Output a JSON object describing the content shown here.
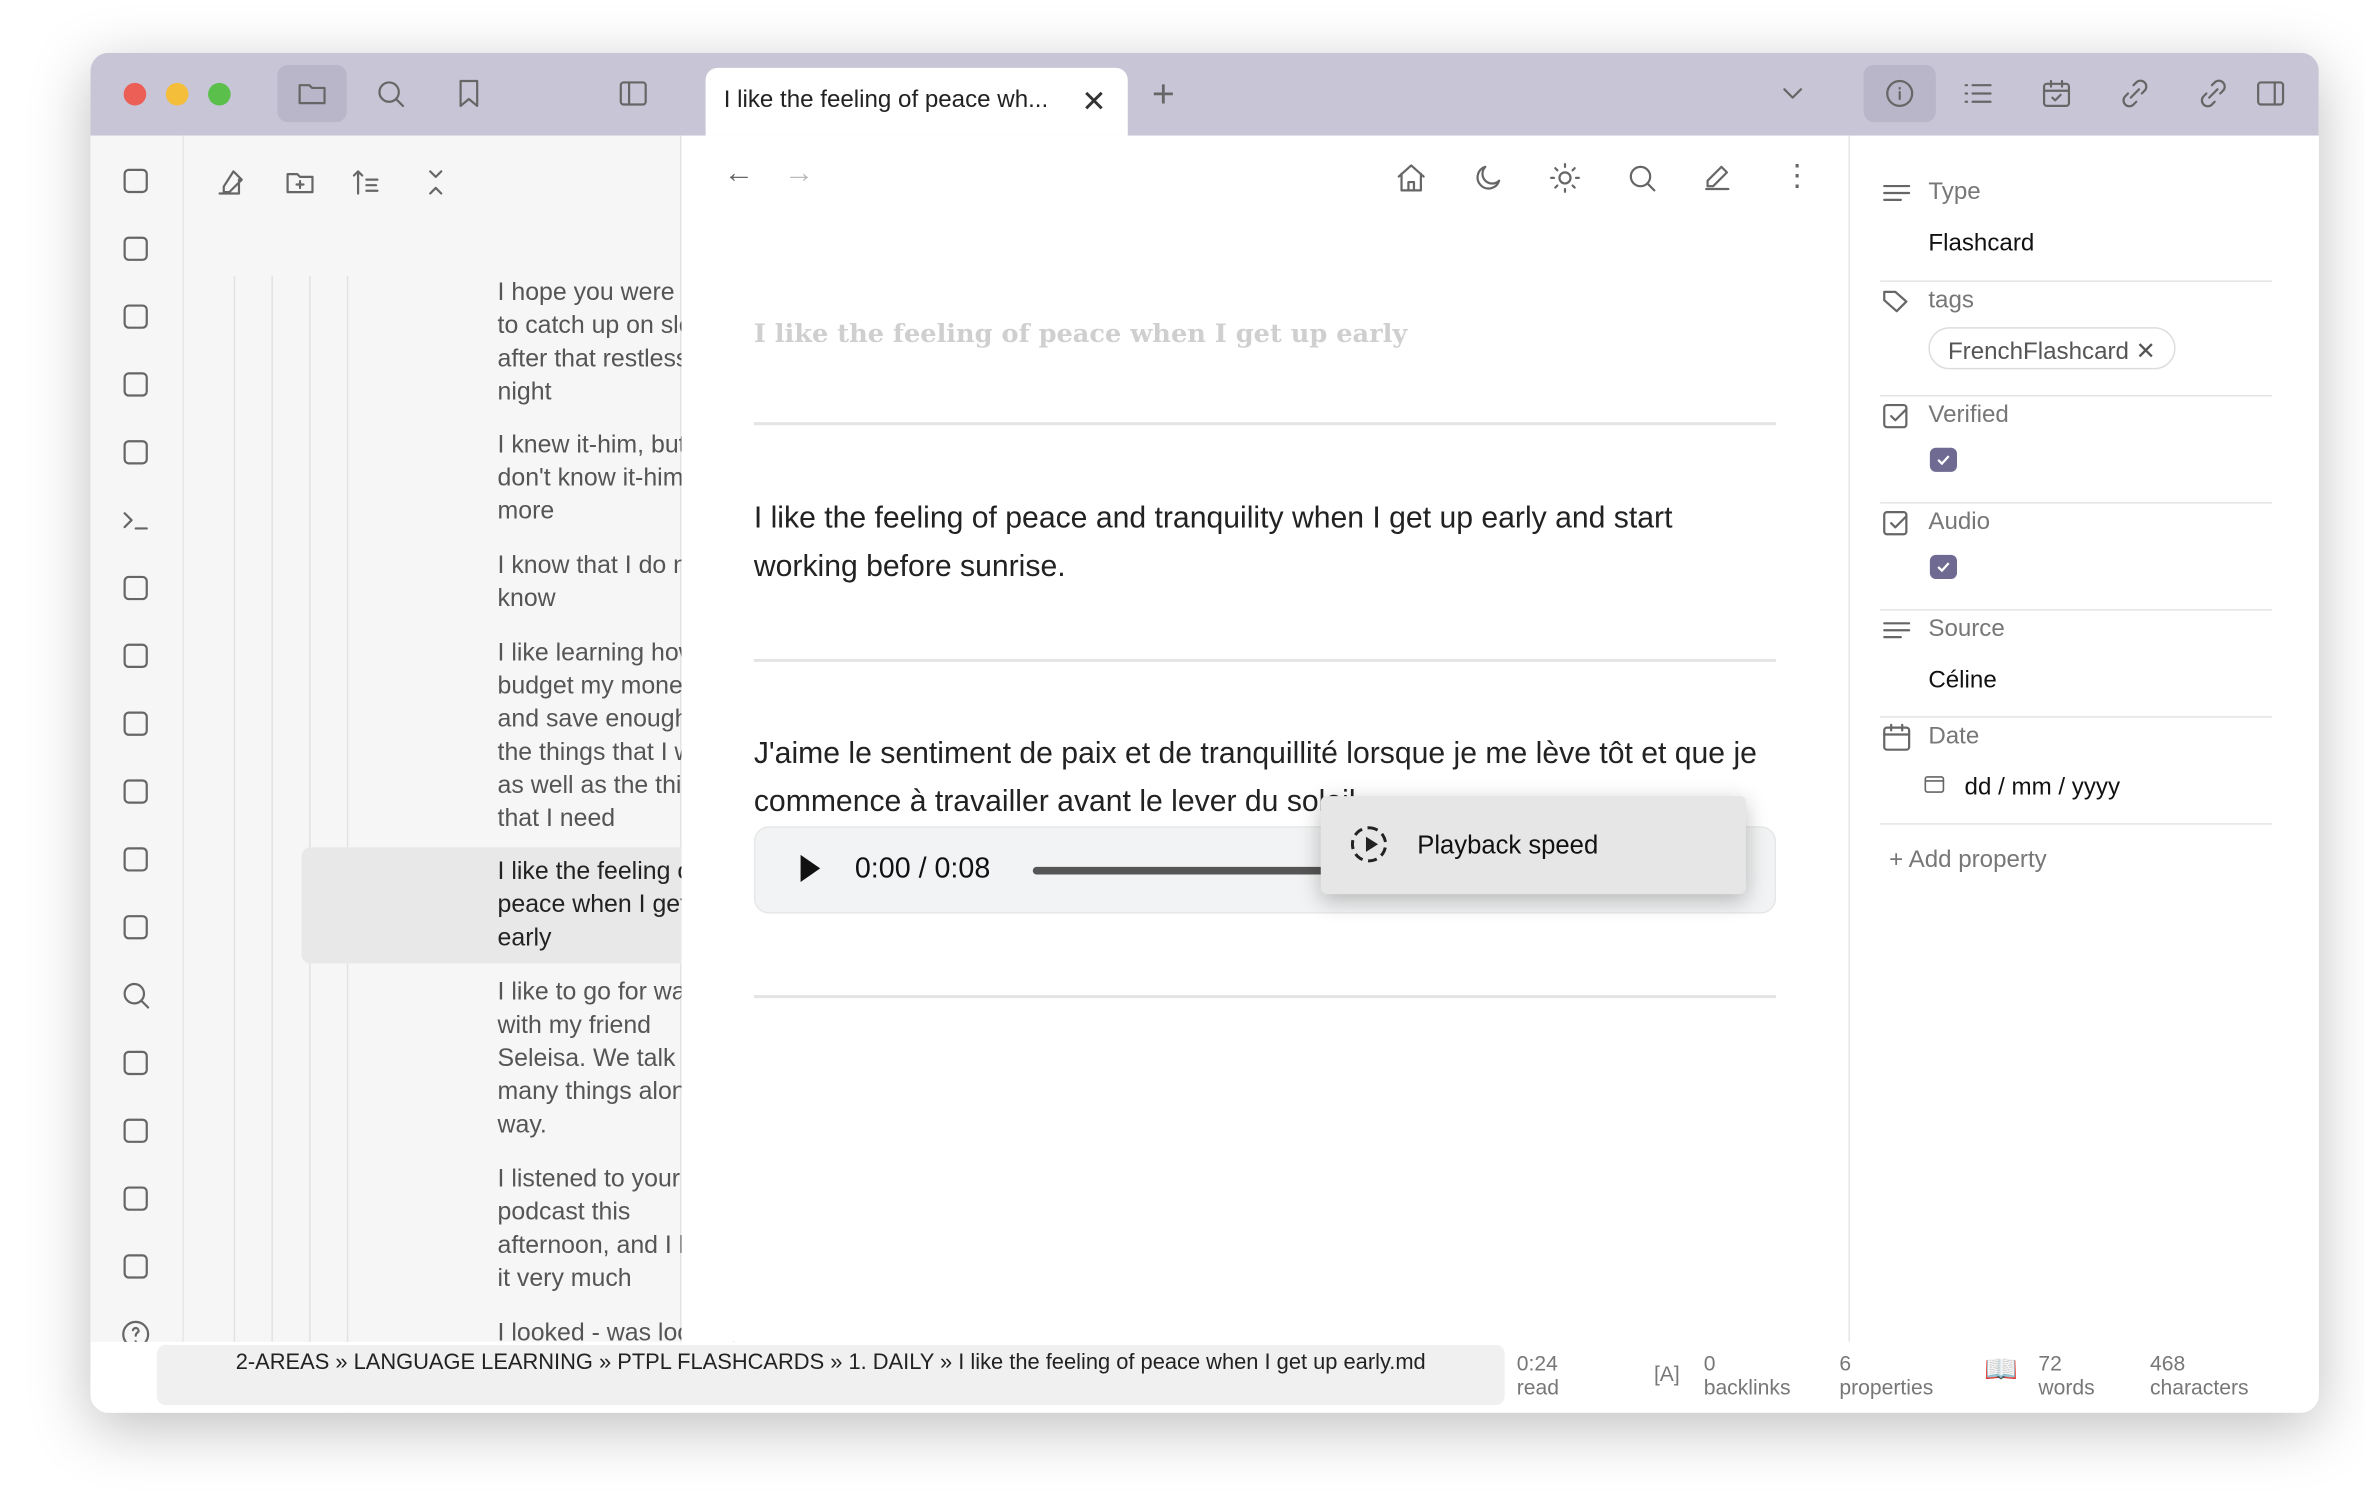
{
  "tab": {
    "title": "I like the feeling of peace wh..."
  },
  "files": {
    "items": [
      "I hope you were able to catch up on sleep after that restless night",
      "I knew it-him, but I don't know it-him any more",
      "I know that I do not know",
      "I like learning how to budget my money, and save enough for the things that I want as well as the things that I need",
      "I like the feeling of peace when I get up early",
      "I like to go for walks with my friend Seleisa. We talk about many things along the way.",
      "I listened to your first podcast this afternoon, and I liked it very much",
      "I looked - was looking - for"
    ],
    "selected_index": 4
  },
  "note": {
    "title": "I like the feeling of peace when I get up early",
    "english": "I like the feeling of peace and tranquility when I get up early and start working before sunrise.",
    "french": "J'aime le sentiment de paix et de tranquillité lorsque je me lève tôt et que je commence à travailler avant le lever du soleil.",
    "audio_time": "0:00 / 0:08",
    "popup_label": "Playback speed"
  },
  "properties": [
    {
      "name": "Type",
      "value": "Flashcard",
      "icon": "text-icon"
    },
    {
      "name": "tags",
      "tag": "FrenchFlashcard",
      "icon": "tags-icon"
    },
    {
      "name": "Verified",
      "checked": true,
      "icon": "checkbox-icon"
    },
    {
      "name": "Audio",
      "checked": true,
      "icon": "checkbox-icon"
    },
    {
      "name": "Source",
      "value": "Céline",
      "icon": "text-icon"
    },
    {
      "name": "Date",
      "value": "dd / mm / yyyy",
      "icon": "calendar-icon"
    }
  ],
  "add_property": "Add property",
  "status": {
    "breadcrumb": "2-AREAS » LANGUAGE LEARNING » PTPL FLASHCARDS » 1. DAILY » I like the feeling of peace when I get up early.md",
    "read_time": "0:24",
    "read_label": "read",
    "lang": "[A]",
    "backlinks": "0",
    "backlinks_label": "backlinks",
    "properties": "6",
    "properties_label": "properties",
    "words": "72",
    "words_label": "words",
    "characters": "468",
    "characters_label": "characters"
  },
  "colors": {
    "titlebar": "#c8c6d6",
    "accent": "#6e6a92"
  }
}
